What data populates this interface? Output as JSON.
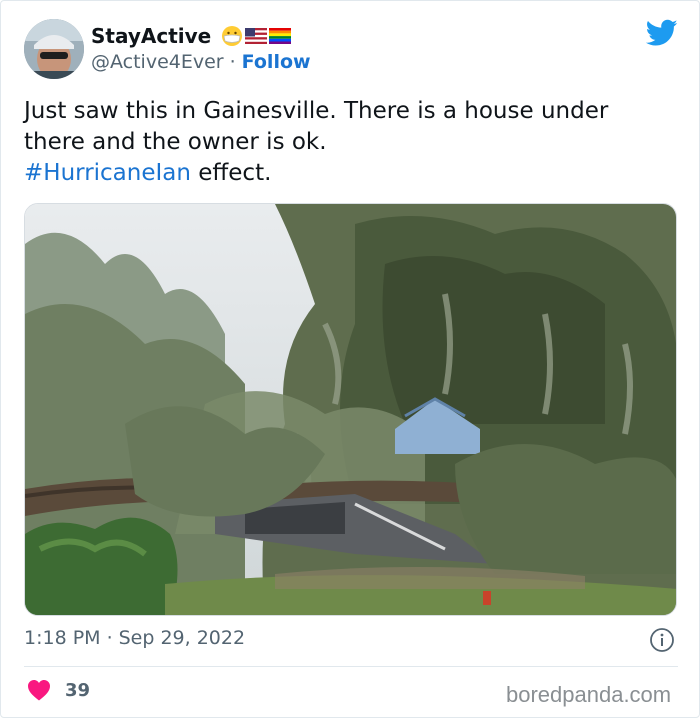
{
  "tweet": {
    "display_name": "StayActive",
    "name_emojis": [
      "face-with-mask-icon",
      "us-flag-icon",
      "rainbow-flag-icon"
    ],
    "handle": "@Active4Ever",
    "separator": "·",
    "follow_label": "Follow",
    "text_line1": "Just saw this in Gainesville. There is a house under",
    "text_line2": "there and the owner is ok.",
    "hashtag": "#HurricaneIan",
    "text_after_hashtag": " effect.",
    "time": "1:18 PM",
    "date": "Sep 29, 2022",
    "likes": "39"
  },
  "watermark": "boredpanda.com",
  "colors": {
    "link_blue": "#1b74d1",
    "twitter_blue": "#1d9bf0",
    "heart_pink": "#f91880",
    "secondary_text": "#536471"
  },
  "icons": [
    "twitter-bird-icon",
    "info-icon",
    "heart-icon"
  ]
}
